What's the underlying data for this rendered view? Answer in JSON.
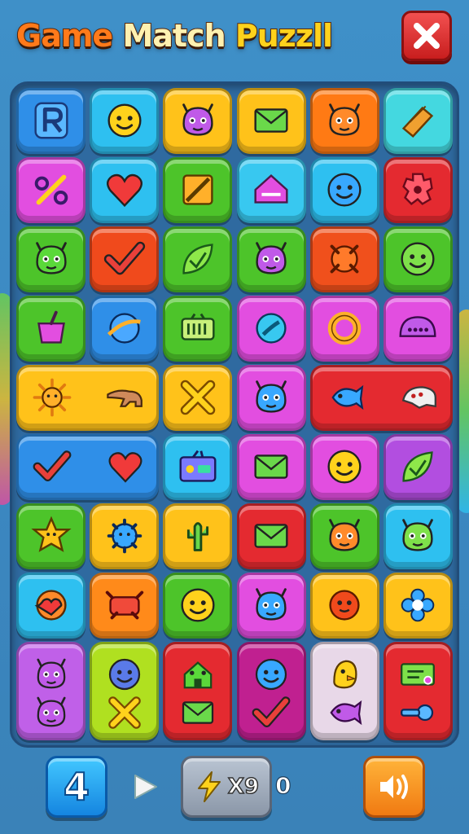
{
  "header": {
    "title_parts": [
      "Game ",
      "Match ",
      "Puzzll"
    ],
    "close_icon": "close-x-icon"
  },
  "board": {
    "columns": 6,
    "rows": 9,
    "tiles": [
      {
        "r": 0,
        "c": 0,
        "w": 1,
        "h": 1,
        "color": "#2f8fe8",
        "icons": [
          "letter-r-icon"
        ]
      },
      {
        "r": 0,
        "c": 1,
        "w": 1,
        "h": 1,
        "color": "#2ec0f0",
        "icons": [
          "smiley-face-icon"
        ]
      },
      {
        "r": 0,
        "c": 2,
        "w": 1,
        "h": 1,
        "color": "#ffc21a",
        "icons": [
          "purple-monster-icon"
        ]
      },
      {
        "r": 0,
        "c": 3,
        "w": 1,
        "h": 1,
        "color": "#ffc21a",
        "icons": [
          "envelope-icon"
        ]
      },
      {
        "r": 0,
        "c": 4,
        "w": 1,
        "h": 1,
        "color": "#ff7a14",
        "icons": [
          "orange-monster-icon"
        ]
      },
      {
        "r": 0,
        "c": 5,
        "w": 1,
        "h": 1,
        "color": "#44d8e0",
        "icons": [
          "wood-block-icon"
        ]
      },
      {
        "r": 1,
        "c": 0,
        "w": 1,
        "h": 1,
        "color": "#e24ee0",
        "icons": [
          "scissors-icon"
        ]
      },
      {
        "r": 1,
        "c": 1,
        "w": 1,
        "h": 1,
        "color": "#2ec0f0",
        "icons": [
          "heart-icon"
        ]
      },
      {
        "r": 1,
        "c": 2,
        "w": 1,
        "h": 1,
        "color": "#4dc42a",
        "icons": [
          "crossed-box-icon"
        ]
      },
      {
        "r": 1,
        "c": 3,
        "w": 1,
        "h": 1,
        "color": "#38c8f0",
        "icons": [
          "house-icon"
        ]
      },
      {
        "r": 1,
        "c": 4,
        "w": 1,
        "h": 1,
        "color": "#2ec0f0",
        "icons": [
          "blue-face-icon"
        ]
      },
      {
        "r": 1,
        "c": 5,
        "w": 1,
        "h": 1,
        "color": "#e42a30",
        "icons": [
          "gear-icon"
        ]
      },
      {
        "r": 2,
        "c": 0,
        "w": 1,
        "h": 1,
        "color": "#4dc42a",
        "icons": [
          "green-monster-icon"
        ]
      },
      {
        "r": 2,
        "c": 1,
        "w": 1,
        "h": 1,
        "color": "#f04a1c",
        "icons": [
          "checkmark-icon"
        ]
      },
      {
        "r": 2,
        "c": 2,
        "w": 1,
        "h": 1,
        "color": "#4dc42a",
        "icons": [
          "leaf-check-icon"
        ]
      },
      {
        "r": 2,
        "c": 3,
        "w": 1,
        "h": 1,
        "color": "#4dc42a",
        "icons": [
          "purple-cat-icon"
        ]
      },
      {
        "r": 2,
        "c": 4,
        "w": 1,
        "h": 1,
        "color": "#f0501c",
        "icons": [
          "orange-ball-icon"
        ]
      },
      {
        "r": 2,
        "c": 5,
        "w": 1,
        "h": 1,
        "color": "#4dc42a",
        "icons": [
          "green-smiley-icon"
        ]
      },
      {
        "r": 3,
        "c": 0,
        "w": 1,
        "h": 1,
        "color": "#4dc42a",
        "icons": [
          "bucket-icon"
        ]
      },
      {
        "r": 3,
        "c": 1,
        "w": 1,
        "h": 1,
        "color": "#2f8fe8",
        "icons": [
          "planet-icon"
        ]
      },
      {
        "r": 3,
        "c": 2,
        "w": 1,
        "h": 1,
        "color": "#4dc42a",
        "icons": [
          "battery-icon"
        ]
      },
      {
        "r": 3,
        "c": 3,
        "w": 1,
        "h": 1,
        "color": "#e24ee0",
        "icons": [
          "globe-icon"
        ]
      },
      {
        "r": 3,
        "c": 4,
        "w": 1,
        "h": 1,
        "color": "#e24ee0",
        "icons": [
          "ring-icon"
        ]
      },
      {
        "r": 3,
        "c": 5,
        "w": 1,
        "h": 1,
        "color": "#e24ee0",
        "icons": [
          "dome-icon"
        ]
      },
      {
        "r": 4,
        "c": 0,
        "w": 2,
        "h": 1,
        "color": "#ffc21a",
        "icons": [
          "sun-icon",
          "anteater-icon"
        ]
      },
      {
        "r": 4,
        "c": 2,
        "w": 1,
        "h": 1,
        "color": "#ffc21a",
        "icons": [
          "x-mark-icon"
        ]
      },
      {
        "r": 4,
        "c": 3,
        "w": 1,
        "h": 1,
        "color": "#e24ee0",
        "icons": [
          "blue-blob-icon"
        ]
      },
      {
        "r": 4,
        "c": 4,
        "w": 2,
        "h": 1,
        "color": "#e42a30",
        "icons": [
          "blue-fish-icon",
          "skull-icon"
        ]
      },
      {
        "r": 5,
        "c": 0,
        "w": 2,
        "h": 1,
        "color": "#2f8fe8",
        "icons": [
          "checkmark-icon",
          "heart-icon"
        ]
      },
      {
        "r": 5,
        "c": 2,
        "w": 1,
        "h": 1,
        "color": "#2ec0f0",
        "icons": [
          "radio-icon"
        ]
      },
      {
        "r": 5,
        "c": 3,
        "w": 1,
        "h": 1,
        "color": "#e24ee0",
        "icons": [
          "envelope-icon"
        ]
      },
      {
        "r": 5,
        "c": 4,
        "w": 1,
        "h": 1,
        "color": "#e24ee0",
        "icons": [
          "yellow-face-icon"
        ]
      },
      {
        "r": 5,
        "c": 5,
        "w": 1,
        "h": 1,
        "color": "#b24ee0",
        "icons": [
          "leaf-check-icon"
        ]
      },
      {
        "r": 6,
        "c": 0,
        "w": 1,
        "h": 1,
        "color": "#4dc42a",
        "icons": [
          "star-face-icon"
        ]
      },
      {
        "r": 6,
        "c": 1,
        "w": 1,
        "h": 1,
        "color": "#ffc21a",
        "icons": [
          "blue-germ-icon"
        ]
      },
      {
        "r": 6,
        "c": 2,
        "w": 1,
        "h": 1,
        "color": "#ffc21a",
        "icons": [
          "cactus-icon"
        ]
      },
      {
        "r": 6,
        "c": 3,
        "w": 1,
        "h": 1,
        "color": "#e42a30",
        "icons": [
          "envelope-icon"
        ]
      },
      {
        "r": 6,
        "c": 4,
        "w": 1,
        "h": 1,
        "color": "#4dc42a",
        "icons": [
          "orange-monster-icon"
        ]
      },
      {
        "r": 6,
        "c": 5,
        "w": 1,
        "h": 1,
        "color": "#2ec0f0",
        "icons": [
          "green-frog-icon"
        ]
      },
      {
        "r": 7,
        "c": 0,
        "w": 1,
        "h": 1,
        "color": "#2ec0f0",
        "icons": [
          "heart-badge-icon"
        ]
      },
      {
        "r": 7,
        "c": 1,
        "w": 1,
        "h": 1,
        "color": "#ff8a1a",
        "icons": [
          "crab-icon"
        ]
      },
      {
        "r": 7,
        "c": 2,
        "w": 1,
        "h": 1,
        "color": "#4dc42a",
        "icons": [
          "yellow-face-icon"
        ]
      },
      {
        "r": 7,
        "c": 3,
        "w": 1,
        "h": 1,
        "color": "#e24ee0",
        "icons": [
          "blue-blob-icon"
        ]
      },
      {
        "r": 7,
        "c": 4,
        "w": 1,
        "h": 1,
        "color": "#ffc21a",
        "icons": [
          "red-ball-icon"
        ]
      },
      {
        "r": 7,
        "c": 5,
        "w": 1,
        "h": 1,
        "color": "#ffc21a",
        "icons": [
          "blue-flower-icon"
        ]
      },
      {
        "r": 8,
        "c": 0,
        "w": 1,
        "h": 1.6,
        "color": "#c060e8",
        "icons": [
          "purple-monster-icon",
          "purple-monster-icon"
        ]
      },
      {
        "r": 8,
        "c": 1,
        "w": 1,
        "h": 1.6,
        "color": "#b0e020",
        "icons": [
          "blue-ball-icon",
          "x-mark-icon"
        ]
      },
      {
        "r": 8,
        "c": 2,
        "w": 1,
        "h": 1.6,
        "color": "#e42a30",
        "icons": [
          "green-house-icon",
          "envelope-icon"
        ]
      },
      {
        "r": 8,
        "c": 3,
        "w": 1,
        "h": 1.6,
        "color": "#c02090",
        "icons": [
          "blue-face-icon",
          "checkmark-icon"
        ]
      },
      {
        "r": 8,
        "c": 4,
        "w": 1,
        "h": 1.6,
        "color": "#e8d8e8",
        "icons": [
          "yellow-bird-icon",
          "purple-fish-icon"
        ]
      },
      {
        "r": 8,
        "c": 5,
        "w": 1,
        "h": 1.6,
        "color": "#e42a30",
        "icons": [
          "ticket-icon",
          "key-icon"
        ]
      }
    ]
  },
  "hud": {
    "level_label": "4",
    "play_icon": "play-arrow-icon",
    "boost_icon": "lightning-icon",
    "boost_count": "X9",
    "score": "0",
    "sound_icon": "sound-waves-icon"
  }
}
